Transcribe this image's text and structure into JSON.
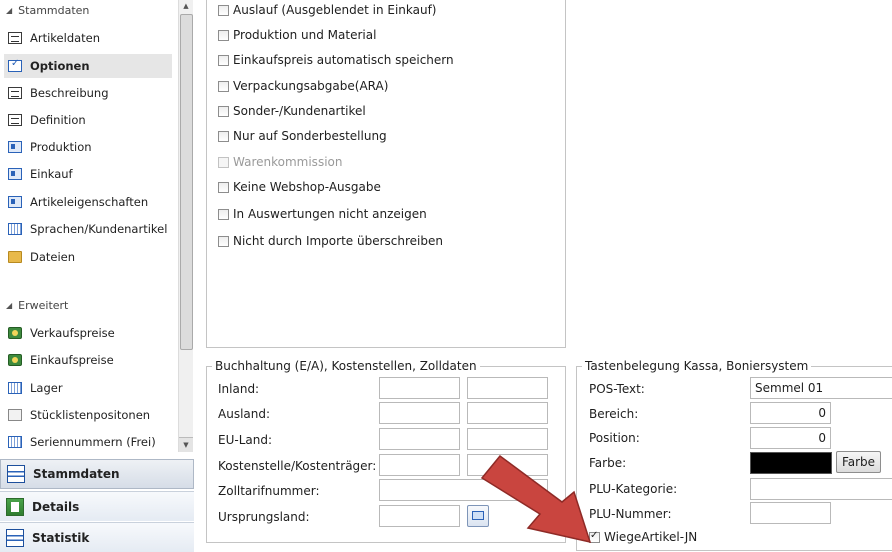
{
  "sidebar": {
    "sections": [
      {
        "label": "Stammdaten"
      },
      {
        "label": "Erweitert"
      }
    ],
    "items": [
      {
        "label": "Artikeldaten"
      },
      {
        "label": "Optionen"
      },
      {
        "label": "Beschreibung"
      },
      {
        "label": "Definition"
      },
      {
        "label": "Produktion"
      },
      {
        "label": "Einkauf"
      },
      {
        "label": "Artikeleigenschaften"
      },
      {
        "label": "Sprachen/Kundenartikel"
      },
      {
        "label": "Dateien"
      },
      {
        "label": "Verkaufspreise"
      },
      {
        "label": "Einkaufspreise"
      },
      {
        "label": "Lager"
      },
      {
        "label": "Stücklistenpositonen"
      },
      {
        "label": "Seriennummern (Frei)"
      }
    ],
    "bottom_nav": [
      {
        "label": "Stammdaten"
      },
      {
        "label": "Details"
      },
      {
        "label": "Statistik"
      }
    ]
  },
  "options": {
    "checkboxes": [
      {
        "label": "Auslauf (Ausgeblendet in Einkauf)",
        "checked": false
      },
      {
        "label": "Produktion und Material",
        "checked": false
      },
      {
        "label": "Einkaufspreis automatisch speichern",
        "checked": false
      },
      {
        "label": "Verpackungsabgabe(ARA)",
        "checked": false
      },
      {
        "label": "Sonder-/Kundenartikel",
        "checked": false
      },
      {
        "label": "Nur auf Sonderbestellung",
        "checked": false
      },
      {
        "label": "Warenkommission",
        "checked": false,
        "disabled": true
      },
      {
        "label": "Keine Webshop-Ausgabe",
        "checked": false
      },
      {
        "label": "In Auswertungen nicht anzeigen",
        "checked": false
      },
      {
        "label": "Nicht durch Importe überschreiben",
        "checked": false
      }
    ]
  },
  "accounting": {
    "title": "Buchhaltung (E/A), Kostenstellen, Zolldaten",
    "rows": [
      {
        "label": "Inland:"
      },
      {
        "label": "Ausland:"
      },
      {
        "label": "EU-Land:"
      },
      {
        "label": "Kostenstelle/Kostenträger:"
      },
      {
        "label": "Zolltarifnummer:"
      },
      {
        "label": "Ursprungsland:"
      }
    ]
  },
  "pos": {
    "title": "Tastenbelegung Kassa, Boniersystem",
    "labels": {
      "pos_text": "POS-Text:",
      "bereich": "Bereich:",
      "position": "Position:",
      "farbe": "Farbe:",
      "plu_kategorie": "PLU-Kategorie:",
      "plu_nummer": "PLU-Nummer:"
    },
    "values": {
      "pos_text": "Semmel 01",
      "bereich": "0",
      "position": "0",
      "farbe_color": "#000000",
      "plu_kategorie": "",
      "plu_nummer": ""
    },
    "farbe_button": "Farbe",
    "wiege": {
      "label": "WiegeArtikel-JN",
      "checked": true
    }
  },
  "colors": {
    "arrow": "#c9453f",
    "active_item_bg": "#e6e6e6"
  }
}
